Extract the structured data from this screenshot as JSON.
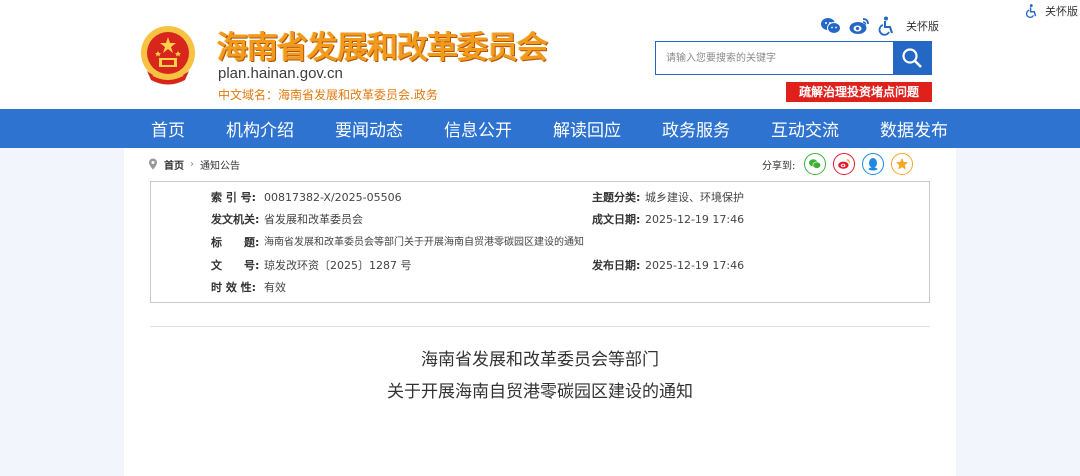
{
  "header": {
    "site_title": "海南省发展和改革委员会",
    "site_domain": "plan.hainan.gov.cn",
    "cn_domain": "中文域名：海南省发展和改革委员会.政务",
    "care_mode": "关怀版",
    "care_mode_corner": "关怀版",
    "search_placeholder": "请输入您要搜索的关键字",
    "promo_badge": "疏解治理投资堵点问题"
  },
  "nav": {
    "items": [
      "首页",
      "机构介绍",
      "要闻动态",
      "信息公开",
      "解读回应",
      "政务服务",
      "互动交流",
      "数据发布"
    ]
  },
  "breadcrumb": {
    "home": "首页",
    "current": "通知公告"
  },
  "share": {
    "label": "分享到:"
  },
  "meta": {
    "index_label": "索 引 号:",
    "index_value": "00817382-X/2025-05506",
    "topic_label": "主题分类:",
    "topic_value": "城乡建设、环境保护",
    "issuer_label": "发文机关:",
    "issuer_value": "省发展和改革委员会",
    "created_label": "成文日期:",
    "created_value": "2025-12-19 17:46",
    "title_label": "标　　题:",
    "title_value": "海南省发展和改革委员会等部门关于开展海南自贸港零碳园区建设的通知",
    "docno_label": "文　　号:",
    "docno_value": "琼发改环资〔2025〕1287 号",
    "published_label": "发布日期:",
    "published_value": "2025-12-19 17:46",
    "validity_label": "时 效 性:",
    "validity_value": "有效"
  },
  "document": {
    "title_line1": "海南省发展和改革委员会等部门",
    "title_line2": "关于开展海南自贸港零碳园区建设的通知"
  },
  "colors": {
    "nav_blue": "#2e73cf",
    "title_orange": "#f19a1c",
    "badge_red": "#e0201b"
  }
}
